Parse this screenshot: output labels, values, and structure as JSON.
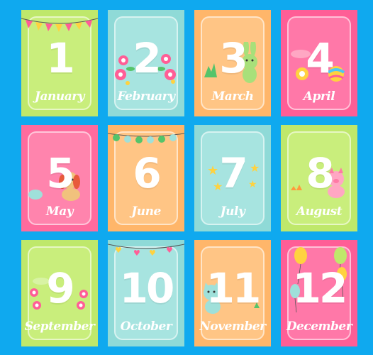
{
  "colors": {
    "background": "#0fa9ef",
    "green": "#bfe86b",
    "teal": "#9fe0da",
    "orange": "#ffbe73",
    "pink": "#ff5e96",
    "light_pink": "#ffc6cf"
  },
  "cards": [
    {
      "number": "1",
      "month": "January",
      "color": "#bfe86b",
      "inner": "#c9ee7c",
      "decor": "bunting-flags"
    },
    {
      "number": "2",
      "month": "February",
      "color": "#8fdad7",
      "inner": "#a7e4e0",
      "decor": "flowers"
    },
    {
      "number": "3",
      "month": "March",
      "color": "#ffb66a",
      "inner": "#ffc585",
      "decor": "bunny"
    },
    {
      "number": "4",
      "month": "April",
      "color": "#ff5e96",
      "inner": "#ff78a8",
      "decor": "balls"
    },
    {
      "number": "5",
      "month": "May",
      "color": "#ff6b9d",
      "inner": "#ff84ad",
      "decor": "puppy"
    },
    {
      "number": "6",
      "month": "June",
      "color": "#ffb66a",
      "inner": "#ffc585",
      "decor": "lantern-string"
    },
    {
      "number": "7",
      "month": "July",
      "color": "#8fdad7",
      "inner": "#a7e4e0",
      "decor": "stars"
    },
    {
      "number": "8",
      "month": "August",
      "color": "#bfe86b",
      "inner": "#c9ee7c",
      "decor": "piglet"
    },
    {
      "number": "9",
      "month": "September",
      "color": "#bfe86b",
      "inner": "#c9ee7c",
      "decor": "flowers"
    },
    {
      "number": "10",
      "month": "October",
      "color": "#8fdad7",
      "inner": "#a7e4e0",
      "decor": "heart-garland"
    },
    {
      "number": "11",
      "month": "November",
      "color": "#ffb66a",
      "inner": "#ffc585",
      "decor": "kitten"
    },
    {
      "number": "12",
      "month": "December",
      "color": "#ff5e96",
      "inner": "#ff78a8",
      "decor": "balloons"
    }
  ]
}
